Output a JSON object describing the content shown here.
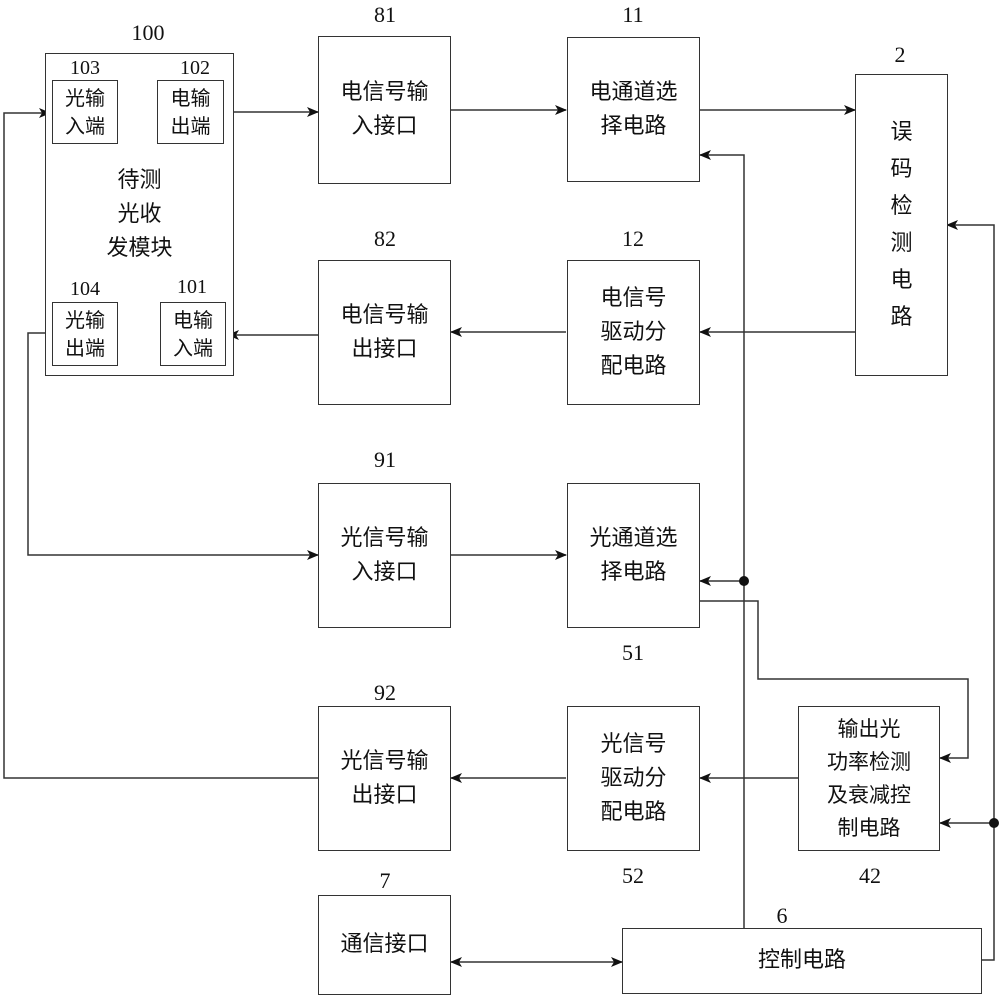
{
  "diagram": {
    "blocks": {
      "module": {
        "id": "100",
        "label": "待测\n光收\n发模块"
      },
      "opt_in_port": {
        "id": "103",
        "label": "光输\n入端"
      },
      "elec_out_port": {
        "id": "102",
        "label": "电输\n出端"
      },
      "opt_out_port": {
        "id": "104",
        "label": "光输\n出端"
      },
      "elec_in_port": {
        "id": "101",
        "label": "电输\n入端"
      },
      "elec_in_if": {
        "id": "81",
        "label": "电信号输\n入接口"
      },
      "elec_out_if": {
        "id": "82",
        "label": "电信号输\n出接口"
      },
      "elec_sel": {
        "id": "11",
        "label": "电通道选\n择电路"
      },
      "elec_drv": {
        "id": "12",
        "label": "电信号\n驱动分\n配电路"
      },
      "ber": {
        "id": "2",
        "label": "误\n码\n检\n测\n电\n路"
      },
      "opt_in_if": {
        "id": "91",
        "label": "光信号输\n入接口"
      },
      "opt_out_if": {
        "id": "92",
        "label": "光信号输\n出接口"
      },
      "opt_sel": {
        "id": "51",
        "label": "光通道选\n择电路"
      },
      "opt_drv": {
        "id": "52",
        "label": "光信号\n驱动分\n配电路"
      },
      "power": {
        "id": "42",
        "label": "输出光\n功率检测\n及衰减控\n制电路"
      },
      "comm": {
        "id": "7",
        "label": "通信接口"
      },
      "ctrl": {
        "id": "6",
        "label": "控制电路"
      }
    },
    "connections": [
      {
        "from": "102",
        "to": "81"
      },
      {
        "from": "81",
        "to": "11"
      },
      {
        "from": "11",
        "to": "2"
      },
      {
        "from": "2",
        "to": "12"
      },
      {
        "from": "12",
        "to": "82"
      },
      {
        "from": "82",
        "to": "101"
      },
      {
        "from": "104",
        "to": "91"
      },
      {
        "from": "91",
        "to": "51"
      },
      {
        "from": "51",
        "to": "42"
      },
      {
        "from": "42",
        "to": "52"
      },
      {
        "from": "52",
        "to": "92"
      },
      {
        "from": "92",
        "to": "103"
      },
      {
        "from": "6",
        "to": "11"
      },
      {
        "from": "6",
        "to": "51"
      },
      {
        "from": "6",
        "to": "2"
      },
      {
        "from": "6",
        "to": "42"
      },
      {
        "from": "7",
        "to": "6",
        "bidirectional": true
      }
    ]
  }
}
